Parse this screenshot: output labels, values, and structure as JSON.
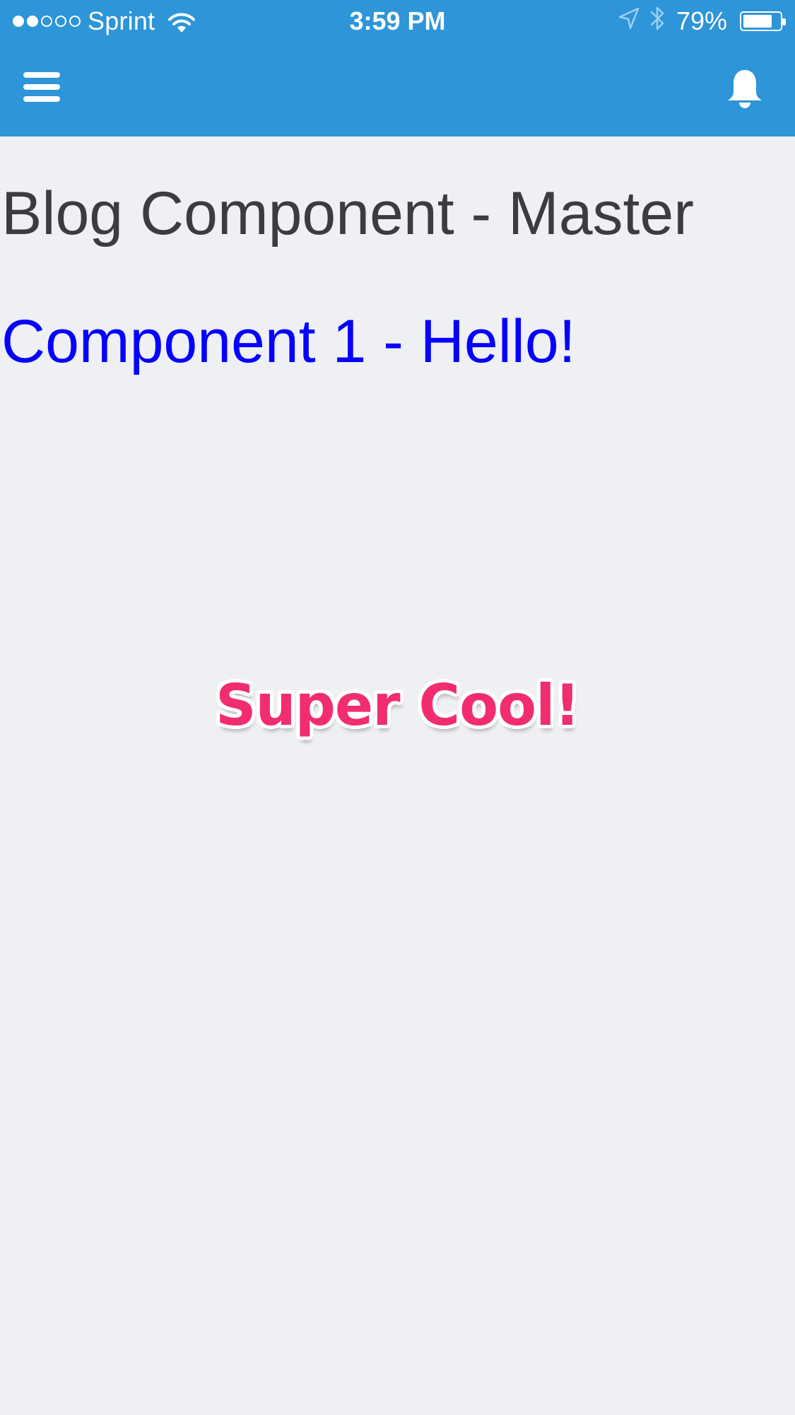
{
  "status_bar": {
    "signal_dots_filled": 2,
    "signal_dots_total": 5,
    "carrier": "Sprint",
    "time": "3:59 PM",
    "battery_percent_label": "79%",
    "battery_level": 0.79,
    "icons": [
      "wifi-icon",
      "location-arrow-icon",
      "bluetooth-icon",
      "battery-icon"
    ]
  },
  "nav_bar": {
    "menu_icon": "hamburger-menu-icon",
    "notification_icon": "bell-icon",
    "background_color": "#2d95d8"
  },
  "content": {
    "page_title": "Blog Component - Master",
    "component_heading": "Component 1 - Hello!",
    "component_heading_color": "#0500ff",
    "sticker_text": "Super Cool!",
    "sticker_color": "#f12d6e"
  }
}
